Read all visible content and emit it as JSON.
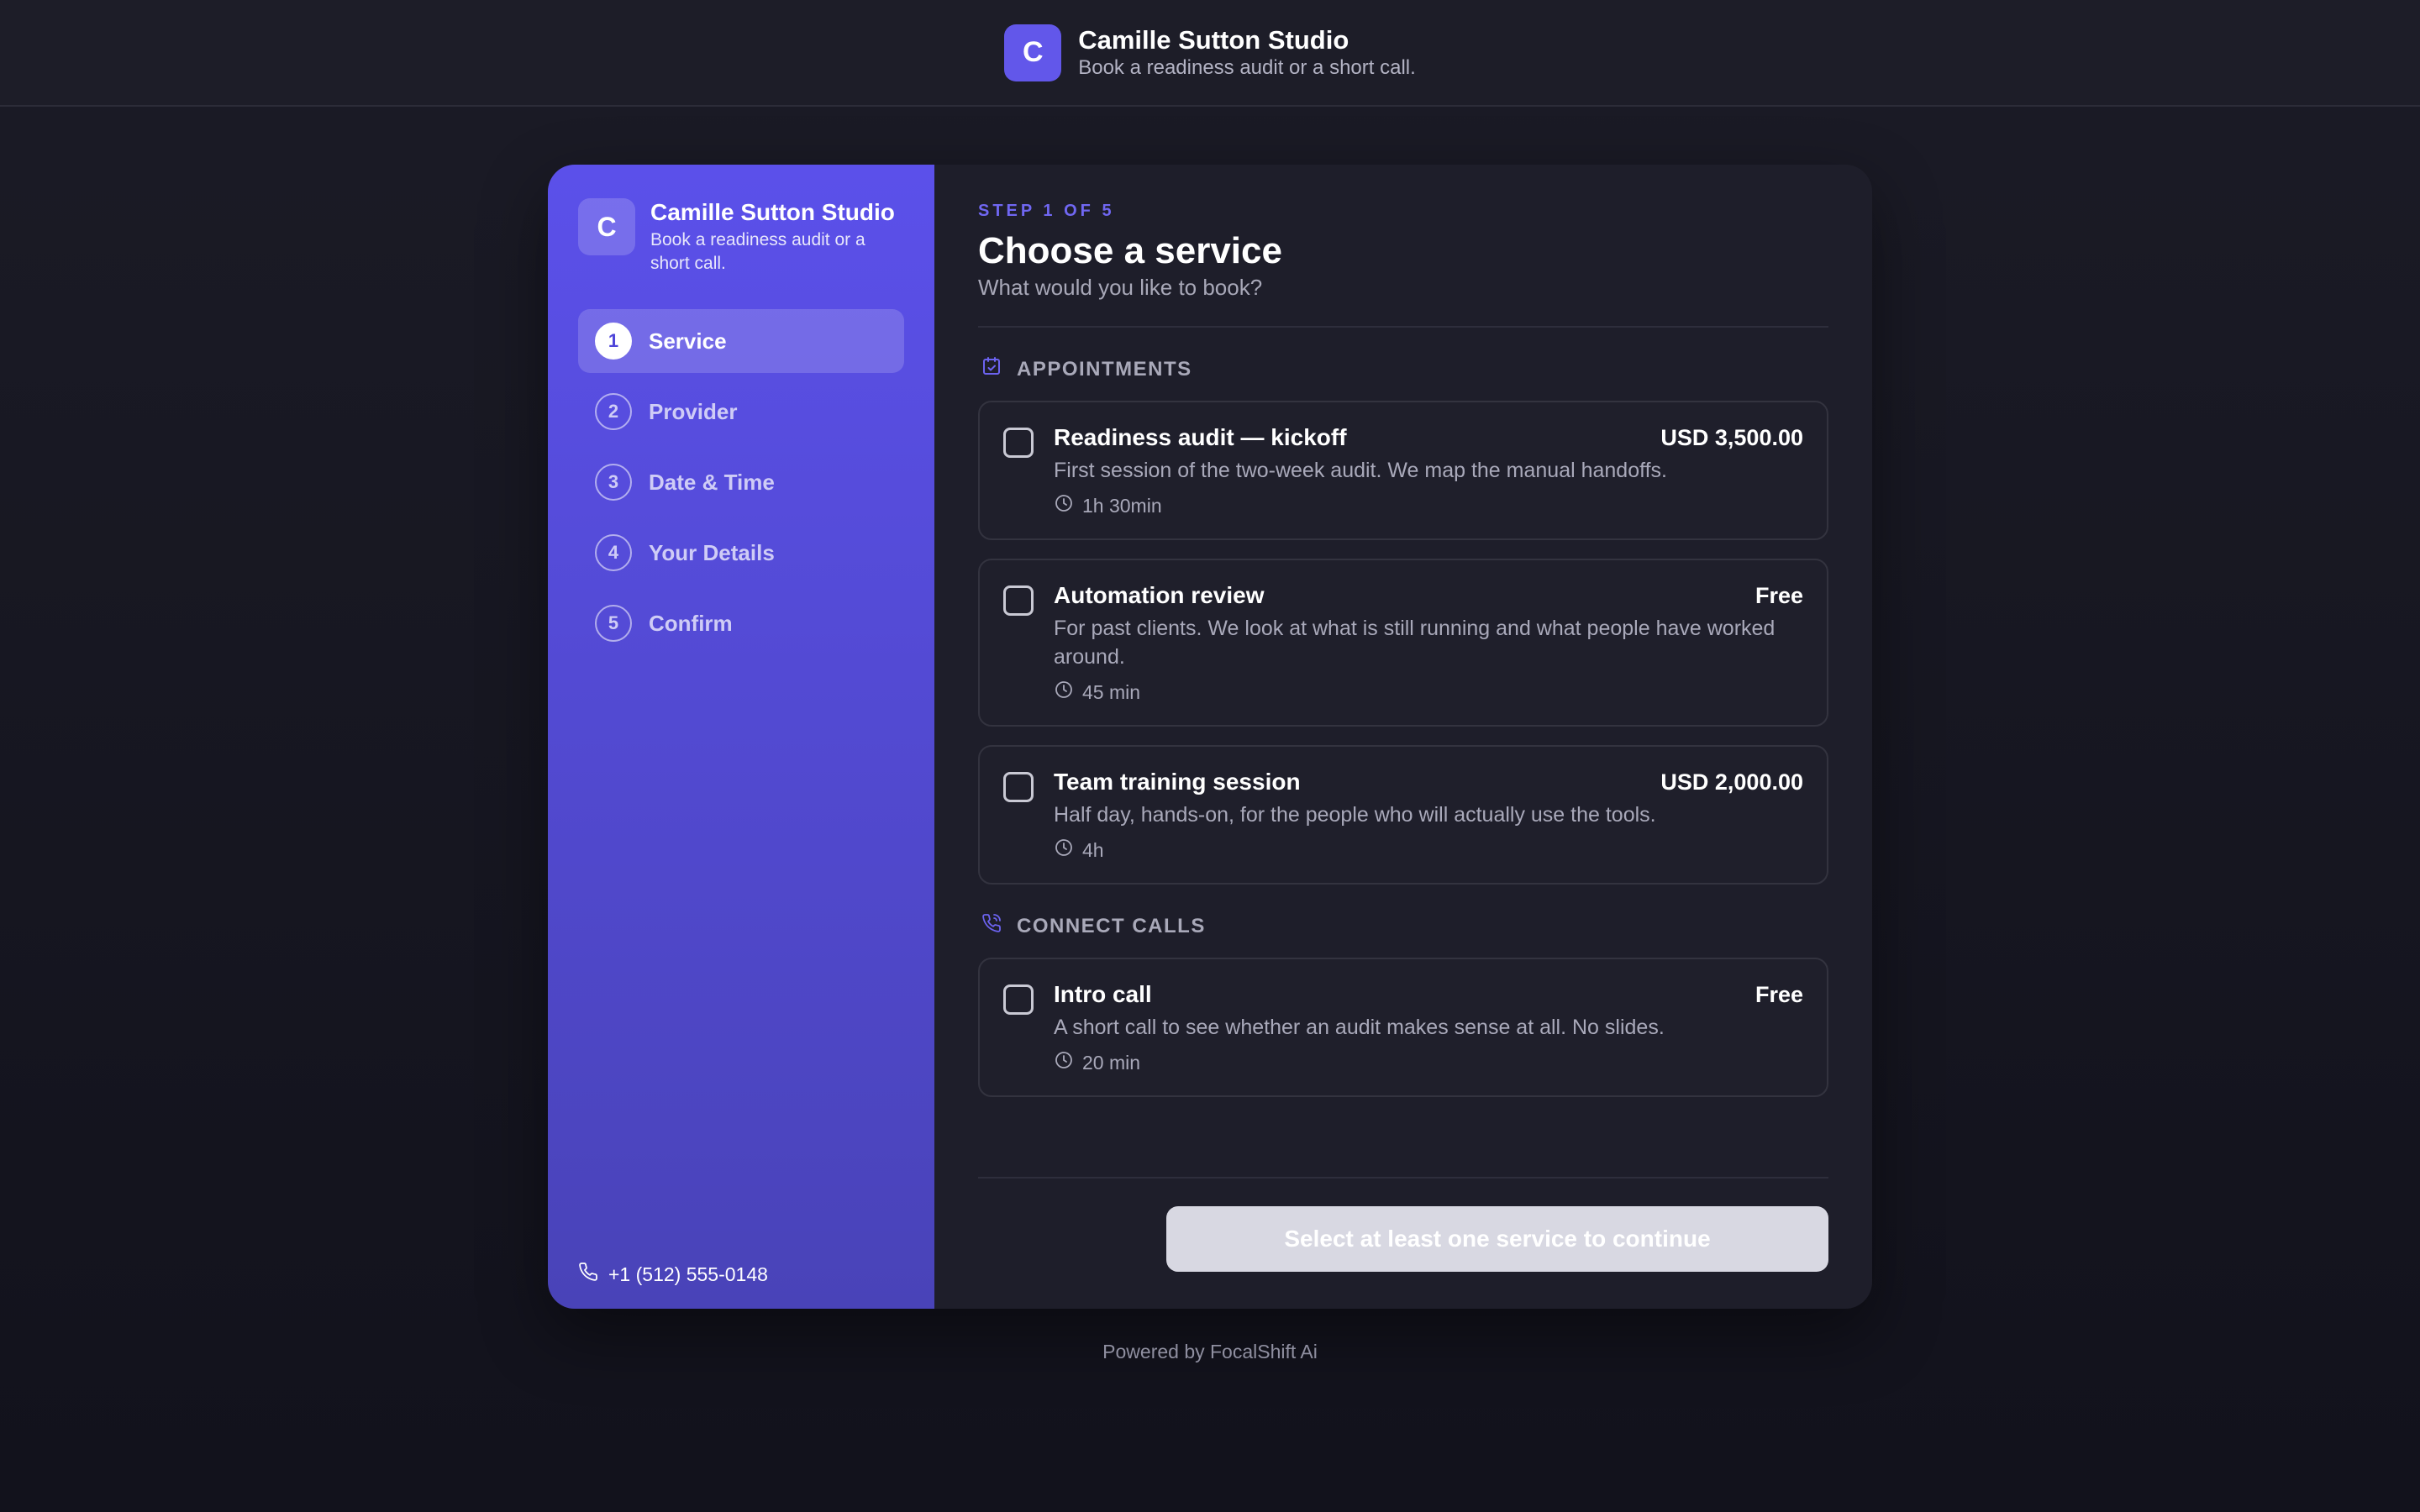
{
  "header": {
    "logo_letter": "C",
    "title": "Camille Sutton Studio",
    "subtitle": "Book a readiness audit or a short call."
  },
  "sidebar": {
    "logo_letter": "C",
    "title": "Camille Sutton Studio",
    "subtitle": "Book a readiness audit or a short call.",
    "steps": [
      {
        "num": "1",
        "label": "Service",
        "active": true
      },
      {
        "num": "2",
        "label": "Provider",
        "active": false
      },
      {
        "num": "3",
        "label": "Date & Time",
        "active": false
      },
      {
        "num": "4",
        "label": "Your Details",
        "active": false
      },
      {
        "num": "5",
        "label": "Confirm",
        "active": false
      }
    ],
    "phone": "+1 (512) 555-0148",
    "phone_icon": "phone-icon"
  },
  "main": {
    "step_label": "STEP 1 OF 5",
    "title": "Choose a service",
    "subtitle": "What would you like to book?",
    "sections": [
      {
        "heading": "APPOINTMENTS",
        "icon": "calendar-check-icon",
        "services": [
          {
            "name": "Readiness audit — kickoff",
            "price": "USD 3,500.00",
            "description": "First session of the two-week audit. We map the manual handoffs.",
            "duration": "1h 30min"
          },
          {
            "name": "Automation review",
            "price": "Free",
            "description": "For past clients. We look at what is still running and what people have worked around.",
            "duration": "45 min"
          },
          {
            "name": "Team training session",
            "price": "USD 2,000.00",
            "description": "Half day, hands-on, for the people who will actually use the tools.",
            "duration": "4h"
          }
        ]
      },
      {
        "heading": "CONNECT CALLS",
        "icon": "phone-call-icon",
        "services": [
          {
            "name": "Intro call",
            "price": "Free",
            "description": "A short call to see whether an audit makes sense at all. No slides.",
            "duration": "20 min"
          }
        ]
      }
    ],
    "continue_label": "Select at least one service to continue"
  },
  "footer": {
    "powered_by": "Powered by FocalShift Ai"
  },
  "colors": {
    "accent": "#6257ea",
    "sidebar_top": "#5b50ea",
    "sidebar_bottom": "#4943b8",
    "background": "#14141e",
    "card": "#1e1e2a",
    "disabled_button": "#d8d8e2"
  }
}
